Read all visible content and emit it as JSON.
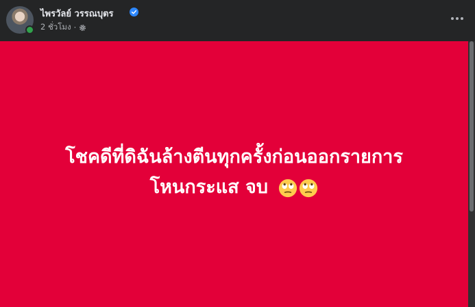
{
  "post": {
    "author": "ไพรวัลย์ วรรณบุตร",
    "time": "2 ชั่วโมง",
    "separator": "·",
    "verified_icon": "verified-badge-icon",
    "privacy_icon": "gear-icon",
    "more_icon": "more-options-icon"
  },
  "background_post": {
    "background_color": "#e30039",
    "line1": "โชคดีที่ดิฉันล้างตีนทุกครั้งก่อนออกรายการ",
    "line2": "โหนกระแส จบ",
    "emoji": [
      "face-with-rolling-eyes",
      "face-with-rolling-eyes"
    ]
  },
  "colors": {
    "header_bg": "#242526",
    "verified": "#2d88ff",
    "online": "#31a24c"
  }
}
